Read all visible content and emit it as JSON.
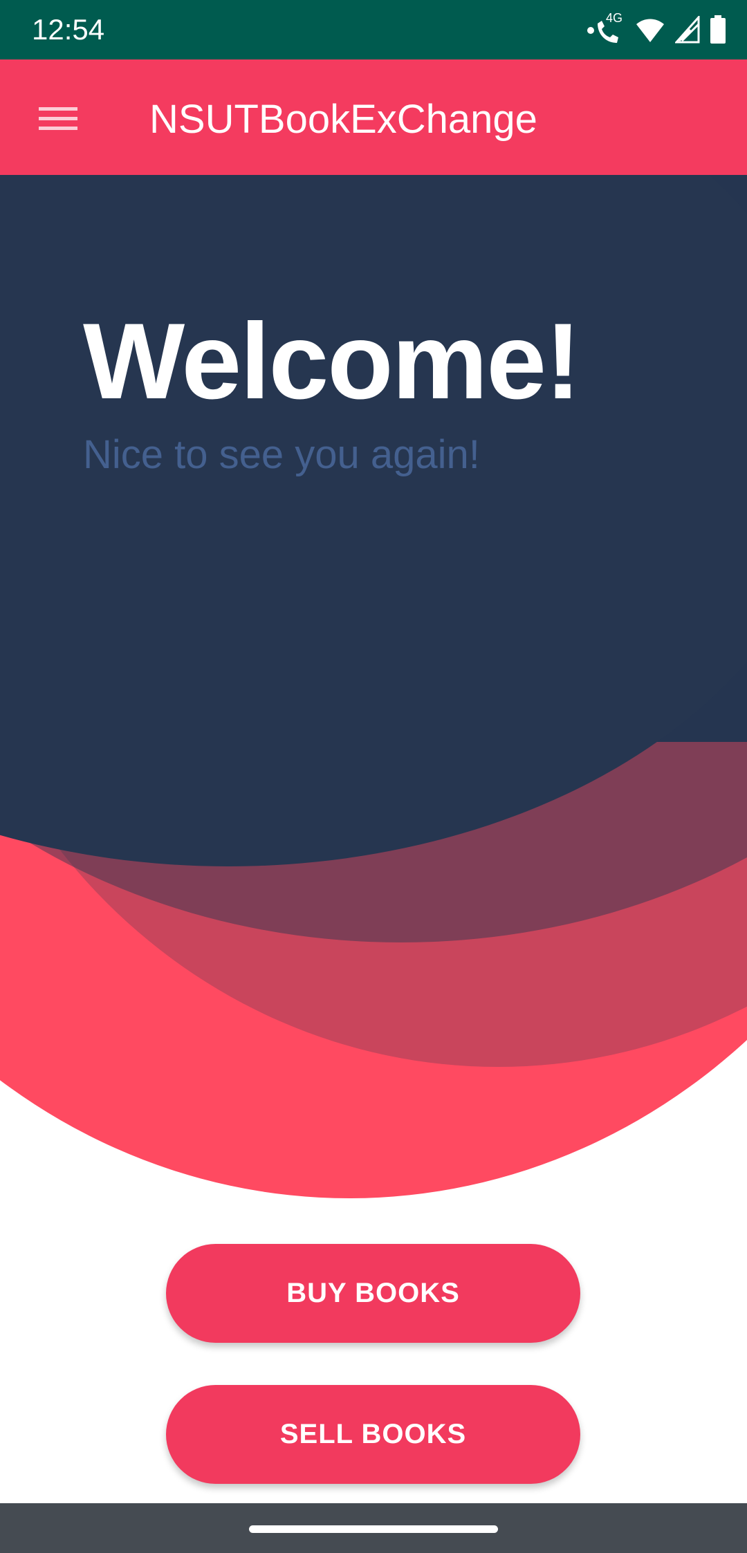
{
  "status_bar": {
    "time": "12:54",
    "network_label": "4G",
    "icons": [
      "call-icon",
      "wifi-icon",
      "signal-icon",
      "battery-icon"
    ]
  },
  "app_bar": {
    "title": "NSUTBookExChange",
    "menu_icon": "hamburger-menu-icon"
  },
  "hero": {
    "title": "Welcome!",
    "subtitle": "Nice to see you again!"
  },
  "actions": {
    "buy_label": "BUY BOOKS",
    "sell_label": "SELL BOOKS"
  },
  "colors": {
    "status_bar": "#005b4f",
    "accent": "#f43b5f",
    "hero_dark": "#263650",
    "hero_red": "#ff4a61",
    "subtitle": "#44608f",
    "nav_bar": "#454b52"
  }
}
